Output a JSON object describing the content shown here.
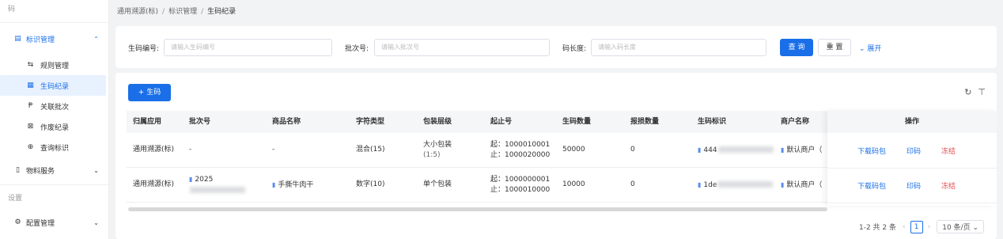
{
  "sidebar": {
    "header": "码",
    "group_main": {
      "label": "标识管理",
      "icon": "tag-icon"
    },
    "items": [
      {
        "label": "规则管理",
        "icon": "rule-icon"
      },
      {
        "label": "生码纪录",
        "icon": "record-icon"
      },
      {
        "label": "关联批次",
        "icon": "link-icon"
      },
      {
        "label": "作废纪录",
        "icon": "void-icon"
      },
      {
        "label": "查询标识",
        "icon": "search-icon"
      }
    ],
    "group_material": {
      "label": "物料服务",
      "icon": "book-icon"
    },
    "section_settings": "设置",
    "group_config": {
      "label": "配置管理",
      "icon": "gear-icon"
    }
  },
  "breadcrumb": [
    "通用溯源(标)",
    "标识管理",
    "生码纪录"
  ],
  "filter": {
    "code_no_label": "生码编号:",
    "code_no_placeholder": "请输入生码编号",
    "batch_label": "批次号:",
    "batch_placeholder": "请输入批次号",
    "length_label": "码长度:",
    "length_placeholder": "请输入码长度",
    "query": "查 询",
    "reset": "重 置",
    "expand": "展开"
  },
  "toolbar": {
    "add": "生码"
  },
  "table": {
    "headers": [
      "归属应用",
      "批次号",
      "商品名称",
      "字符类型",
      "包装层级",
      "起止号",
      "生码数量",
      "报损数量",
      "生码标识",
      "商户名称",
      "操作"
    ],
    "rows": [
      {
        "app": "通用溯源(标)",
        "batch": "-",
        "product": "-",
        "char_type": "混合(15)",
        "pack_level": "大小包装",
        "pack_level_sub": "(1:5)",
        "start": "起：1000010001",
        "end": "止：1000020000",
        "count": "50000",
        "damaged": "0",
        "code_id": "444",
        "merchant": "默认商户（"
      },
      {
        "app": "通用溯源(标)",
        "batch": "2025",
        "product": "手撕牛肉干",
        "char_type": "数字(10)",
        "pack_level": "单个包装",
        "pack_level_sub": "",
        "start": "起：1000000001",
        "end": "止：1000010000",
        "count": "10000",
        "damaged": "0",
        "code_id": "1de",
        "merchant": "默认商户（"
      }
    ],
    "actions": {
      "download": "下载码包",
      "print": "印码",
      "freeze": "冻结"
    }
  },
  "pagination": {
    "summary": "1-2 共 2 条",
    "current": "1",
    "size": "10 条/页"
  },
  "colors": {
    "primary": "#1a6fe8",
    "danger": "#e34d4d"
  }
}
